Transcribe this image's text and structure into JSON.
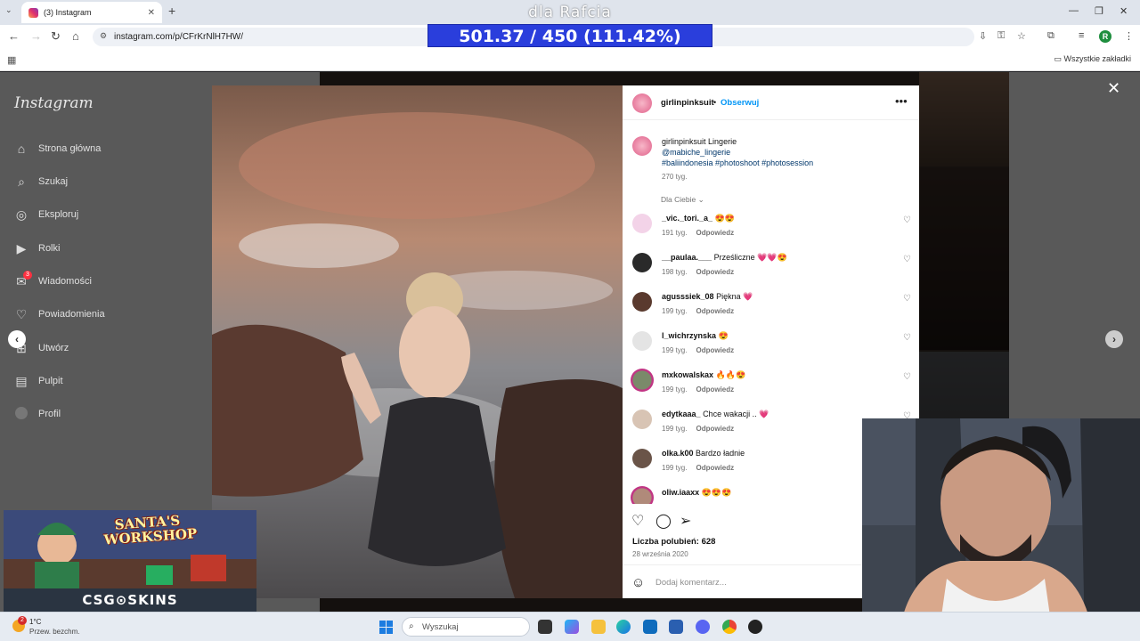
{
  "browser": {
    "tab_title": "(3) Instagram",
    "url": "instagram.com/p/CFrKrNlH7HW/",
    "bookmarks_all": "Wszystkie zakładki",
    "profile_initial": "R"
  },
  "overlay": {
    "title": "dla Rafcia",
    "score": "501.37 / 450 (111.42%)"
  },
  "sidebar": {
    "logo": "Instagram",
    "items": [
      {
        "label": "Strona główna",
        "icon": "home-icon"
      },
      {
        "label": "Szukaj",
        "icon": "search-icon"
      },
      {
        "label": "Eksploruj",
        "icon": "compass-icon"
      },
      {
        "label": "Rolki",
        "icon": "reels-icon"
      },
      {
        "label": "Wiadomości",
        "icon": "messenger-icon",
        "badge": "3"
      },
      {
        "label": "Powiadomienia",
        "icon": "heart-icon"
      },
      {
        "label": "Utwórz",
        "icon": "plus-icon"
      },
      {
        "label": "Pulpit",
        "icon": "dashboard-icon"
      },
      {
        "label": "Profil",
        "icon": "avatar-icon"
      }
    ]
  },
  "post": {
    "username": "girlinpinksuit",
    "separator": "•",
    "follow": "Obserwuj",
    "caption_user": "girlinpinksuit",
    "caption_text": "Lingerie",
    "mention": "@mabiche_lingerie",
    "hashtags": "#baliindonesia #photoshoot #photosession",
    "caption_time": "270 tyg.",
    "for_you": "Dla Ciebie",
    "likes": "Liczba polubień: 628",
    "date": "28 września 2020",
    "add_comment": "Dodaj komentarz..."
  },
  "comments": [
    {
      "user": "_vic._tori._a_",
      "text": "😍😍",
      "time": "191 tyg.",
      "reply": "Odpowiedz"
    },
    {
      "user": "__paulaa.___",
      "text": "Prześliczne 💗💗😍",
      "time": "198 tyg.",
      "reply": "Odpowiedz"
    },
    {
      "user": "agusssiek_08",
      "text": "Piękna 💗",
      "time": "199 tyg.",
      "reply": "Odpowiedz"
    },
    {
      "user": "l_wichrzynska",
      "text": "😍",
      "time": "199 tyg.",
      "reply": "Odpowiedz"
    },
    {
      "user": "mxkowalskax",
      "text": "🔥🔥😍",
      "time": "199 tyg.",
      "reply": "Odpowiedz"
    },
    {
      "user": "edytkaaa_",
      "text": "Chce wakacji .. 💗",
      "time": "199 tyg.",
      "reply": "Odpowiedz"
    },
    {
      "user": "olka.k00",
      "text": "Bardzo ładnie",
      "time": "199 tyg.",
      "reply": "Odpowiedz"
    },
    {
      "user": "oliw.iaaxx",
      "text": "😍😍😍",
      "time": "",
      "reply": ""
    }
  ],
  "ad": {
    "title": "SANTA'S WORKSHOP",
    "brand": "CSG⊙SKINS"
  },
  "taskbar": {
    "temp": "1°C",
    "weather": "Przew. bezchm.",
    "weather_badge": "2",
    "search": "Wyszukaj"
  }
}
